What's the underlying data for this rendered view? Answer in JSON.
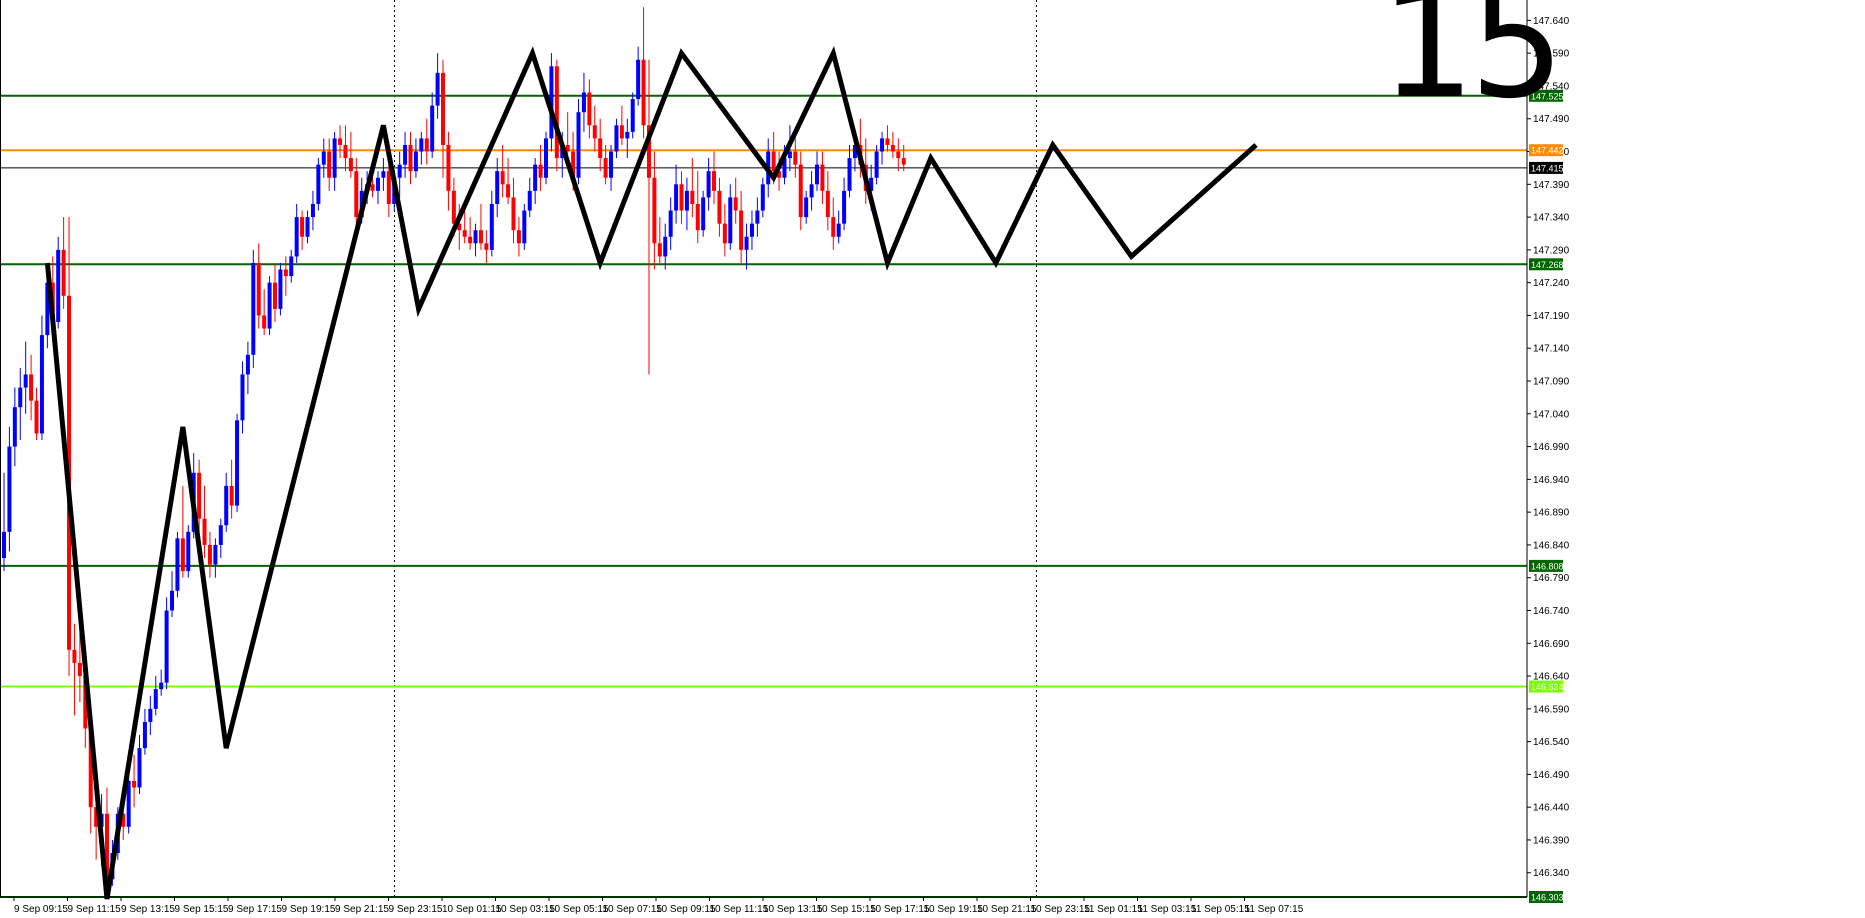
{
  "timeframe_label": "15",
  "chart_data": {
    "type": "candlestick",
    "colors": {
      "bull": "#0000ff",
      "bear": "#ff0000",
      "support_resistance": "#006400",
      "current_price": "#ff8c00",
      "bid_line": "#000000",
      "light_level": "#7cfc00",
      "zigzag": "#000000"
    },
    "ylim": [
      146.303,
      147.665
    ],
    "grid": false,
    "price_ticks": [
      "147.640",
      "147.590",
      "147.540",
      "147.490",
      "147.440",
      "147.390",
      "147.340",
      "147.290",
      "147.240",
      "147.190",
      "147.140",
      "147.090",
      "147.040",
      "146.990",
      "146.940",
      "146.890",
      "146.840",
      "146.790",
      "146.740",
      "146.690",
      "146.640",
      "146.590",
      "146.540",
      "146.490",
      "146.440",
      "146.390",
      "146.340"
    ],
    "time_labels": [
      "9 Sep 09:15",
      "9 Sep 11:15",
      "9 Sep 13:15",
      "9 Sep 15:15",
      "9 Sep 17:15",
      "9 Sep 19:15",
      "9 Sep 21:15",
      "9 Sep 23:15",
      "10 Sep 01:15",
      "10 Sep 03:15",
      "10 Sep 05:15",
      "10 Sep 07:15",
      "10 Sep 09:15",
      "10 Sep 11:15",
      "10 Sep 13:15",
      "10 Sep 15:15",
      "10 Sep 17:15",
      "10 Sep 19:15",
      "10 Sep 21:15",
      "10 Sep 23:15",
      "11 Sep 01:15",
      "11 Sep 03:15",
      "11 Sep 05:15",
      "11 Sep 07:15"
    ],
    "horizontal_levels": [
      {
        "price": 147.525,
        "label": "147.525",
        "kind": "support_resistance"
      },
      {
        "price": 147.442,
        "label": "147.442",
        "kind": "current_price"
      },
      {
        "price": 147.415,
        "label": "147.415",
        "kind": "bid_line"
      },
      {
        "price": 147.268,
        "label": "147.268",
        "kind": "support_resistance"
      },
      {
        "price": 146.808,
        "label": "146.808",
        "kind": "support_resistance"
      },
      {
        "price": 146.624,
        "label": "146.624",
        "kind": "light_level"
      },
      {
        "price": 146.303,
        "label": "146.303",
        "kind": "support_resistance"
      }
    ],
    "day_separators": [
      "9 Sep 23:15",
      "10 Sep 23:15"
    ],
    "zigzag": [
      {
        "t": 8.0,
        "p": 147.27
      },
      {
        "t": 19.0,
        "p": 146.3
      },
      {
        "t": 33.0,
        "p": 147.02
      },
      {
        "t": 41.0,
        "p": 146.53
      },
      {
        "t": 70.0,
        "p": 147.48
      },
      {
        "t": 76.5,
        "p": 147.2
      },
      {
        "t": 97.5,
        "p": 147.59
      },
      {
        "t": 110.0,
        "p": 147.27
      },
      {
        "t": 125.0,
        "p": 147.59
      },
      {
        "t": 142.0,
        "p": 147.4
      },
      {
        "t": 153.0,
        "p": 147.59
      },
      {
        "t": 163.0,
        "p": 147.27
      },
      {
        "t": 171.0,
        "p": 147.43
      },
      {
        "t": 183.0,
        "p": 147.27
      },
      {
        "t": 193.5,
        "p": 147.45
      },
      {
        "t": 208.0,
        "p": 147.28
      },
      {
        "t": 231.0,
        "p": 147.45
      }
    ],
    "candles": [
      [
        146.82,
        146.95,
        146.8,
        146.86
      ],
      [
        146.86,
        147.02,
        146.83,
        146.99
      ],
      [
        146.99,
        147.08,
        146.96,
        147.05
      ],
      [
        147.05,
        147.11,
        147.0,
        147.08
      ],
      [
        147.08,
        147.15,
        147.04,
        147.1
      ],
      [
        147.1,
        147.13,
        147.03,
        147.06
      ],
      [
        147.06,
        147.08,
        147.0,
        147.01
      ],
      [
        147.01,
        147.19,
        147.0,
        147.16
      ],
      [
        147.16,
        147.27,
        147.14,
        147.24
      ],
      [
        147.24,
        147.28,
        147.16,
        147.18
      ],
      [
        147.18,
        147.31,
        147.17,
        147.29
      ],
      [
        147.29,
        147.34,
        147.2,
        147.22
      ],
      [
        147.22,
        147.34,
        146.64,
        146.68
      ],
      [
        146.68,
        146.72,
        146.58,
        146.66
      ],
      [
        146.66,
        146.74,
        146.6,
        146.64
      ],
      [
        146.64,
        146.65,
        146.53,
        146.56
      ],
      [
        146.56,
        146.59,
        146.4,
        146.44
      ],
      [
        146.44,
        146.47,
        146.36,
        146.41
      ],
      [
        146.41,
        146.46,
        146.35,
        146.43
      ],
      [
        146.43,
        146.47,
        146.31,
        146.33
      ],
      [
        146.33,
        146.39,
        146.32,
        146.37
      ],
      [
        146.37,
        146.44,
        146.36,
        146.43
      ],
      [
        146.43,
        146.45,
        146.39,
        146.41
      ],
      [
        146.41,
        146.5,
        146.4,
        146.48
      ],
      [
        146.48,
        146.52,
        146.44,
        146.47
      ],
      [
        146.47,
        146.55,
        146.46,
        146.53
      ],
      [
        146.53,
        146.59,
        146.52,
        146.57
      ],
      [
        146.57,
        146.61,
        146.55,
        146.59
      ],
      [
        146.59,
        146.64,
        146.58,
        146.62
      ],
      [
        146.62,
        146.65,
        146.61,
        146.63
      ],
      [
        146.63,
        146.76,
        146.62,
        146.74
      ],
      [
        146.74,
        146.8,
        146.73,
        146.77
      ],
      [
        146.77,
        146.86,
        146.76,
        146.85
      ],
      [
        146.85,
        146.93,
        146.79,
        146.8
      ],
      [
        146.8,
        146.87,
        146.79,
        146.86
      ],
      [
        146.86,
        146.98,
        146.85,
        146.95
      ],
      [
        146.95,
        146.97,
        146.86,
        146.88
      ],
      [
        146.88,
        146.93,
        146.82,
        146.84
      ],
      [
        146.84,
        146.86,
        146.79,
        146.81
      ],
      [
        146.81,
        146.85,
        146.79,
        146.84
      ],
      [
        146.84,
        146.88,
        146.82,
        146.87
      ],
      [
        146.87,
        146.95,
        146.86,
        146.93
      ],
      [
        146.93,
        146.97,
        146.88,
        146.9
      ],
      [
        146.9,
        147.04,
        146.89,
        147.03
      ],
      [
        147.03,
        147.12,
        147.01,
        147.1
      ],
      [
        147.1,
        147.15,
        147.07,
        147.13
      ],
      [
        147.13,
        147.29,
        147.11,
        147.27
      ],
      [
        147.27,
        147.3,
        147.17,
        147.19
      ],
      [
        147.19,
        147.23,
        147.16,
        147.17
      ],
      [
        147.17,
        147.25,
        147.16,
        147.24
      ],
      [
        147.24,
        147.27,
        147.18,
        147.2
      ],
      [
        147.2,
        147.27,
        147.19,
        147.26
      ],
      [
        147.26,
        147.28,
        147.22,
        147.25
      ],
      [
        147.25,
        147.29,
        147.24,
        147.28
      ],
      [
        147.28,
        147.36,
        147.27,
        147.34
      ],
      [
        147.34,
        147.35,
        147.29,
        147.31
      ],
      [
        147.31,
        147.35,
        147.3,
        147.34
      ],
      [
        147.34,
        147.38,
        147.32,
        147.36
      ],
      [
        147.36,
        147.43,
        147.35,
        147.42
      ],
      [
        147.42,
        147.46,
        147.4,
        147.44
      ],
      [
        147.44,
        147.46,
        147.38,
        147.4
      ],
      [
        147.4,
        147.47,
        147.38,
        147.46
      ],
      [
        147.46,
        147.48,
        147.43,
        147.45
      ],
      [
        147.45,
        147.48,
        147.41,
        147.43
      ],
      [
        147.43,
        147.47,
        147.4,
        147.41
      ],
      [
        147.41,
        147.43,
        147.32,
        147.34
      ],
      [
        147.34,
        147.4,
        147.33,
        147.38
      ],
      [
        147.38,
        147.41,
        147.36,
        147.39
      ],
      [
        147.39,
        147.42,
        147.37,
        147.38
      ],
      [
        147.38,
        147.41,
        147.36,
        147.4
      ],
      [
        147.4,
        147.43,
        147.38,
        147.41
      ],
      [
        147.41,
        147.42,
        147.34,
        147.36
      ],
      [
        147.36,
        147.41,
        147.35,
        147.4
      ],
      [
        147.4,
        147.44,
        147.37,
        147.42
      ],
      [
        147.42,
        147.47,
        147.4,
        147.45
      ],
      [
        147.45,
        147.47,
        147.39,
        147.41
      ],
      [
        147.41,
        147.46,
        147.4,
        147.44
      ],
      [
        147.44,
        147.47,
        147.42,
        147.46
      ],
      [
        147.46,
        147.49,
        147.42,
        147.44
      ],
      [
        147.44,
        147.53,
        147.43,
        147.51
      ],
      [
        147.51,
        147.59,
        147.49,
        147.56
      ],
      [
        147.56,
        147.58,
        147.4,
        147.45
      ],
      [
        147.45,
        147.47,
        147.35,
        147.38
      ],
      [
        147.38,
        147.4,
        147.31,
        147.33
      ],
      [
        147.33,
        147.36,
        147.29,
        147.32
      ],
      [
        147.32,
        147.35,
        147.3,
        147.31
      ],
      [
        147.31,
        147.34,
        147.29,
        147.3
      ],
      [
        147.3,
        147.33,
        147.28,
        147.32
      ],
      [
        147.32,
        147.36,
        147.29,
        147.3
      ],
      [
        147.3,
        147.32,
        147.27,
        147.29
      ],
      [
        147.29,
        147.38,
        147.28,
        147.36
      ],
      [
        147.36,
        147.43,
        147.34,
        147.41
      ],
      [
        147.41,
        147.45,
        147.37,
        147.39
      ],
      [
        147.39,
        147.43,
        147.36,
        147.37
      ],
      [
        147.37,
        147.4,
        147.3,
        147.32
      ],
      [
        147.32,
        147.34,
        147.28,
        147.3
      ],
      [
        147.3,
        147.36,
        147.29,
        147.35
      ],
      [
        147.35,
        147.4,
        147.34,
        147.38
      ],
      [
        147.38,
        147.43,
        147.36,
        147.42
      ],
      [
        147.42,
        147.45,
        147.38,
        147.4
      ],
      [
        147.4,
        147.47,
        147.39,
        147.46
      ],
      [
        147.46,
        147.59,
        147.44,
        147.57
      ],
      [
        147.57,
        147.58,
        147.41,
        147.43
      ],
      [
        147.43,
        147.47,
        147.4,
        147.45
      ],
      [
        147.45,
        147.5,
        147.42,
        147.44
      ],
      [
        147.44,
        147.47,
        147.38,
        147.4
      ],
      [
        147.4,
        147.52,
        147.39,
        147.5
      ],
      [
        147.5,
        147.56,
        147.47,
        147.53
      ],
      [
        147.53,
        147.55,
        147.46,
        147.48
      ],
      [
        147.48,
        147.51,
        147.44,
        147.46
      ],
      [
        147.46,
        147.49,
        147.41,
        147.43
      ],
      [
        147.43,
        147.45,
        147.39,
        147.4
      ],
      [
        147.4,
        147.45,
        147.38,
        147.44
      ],
      [
        147.44,
        147.49,
        147.43,
        147.48
      ],
      [
        147.48,
        147.51,
        147.45,
        147.46
      ],
      [
        147.46,
        147.49,
        147.43,
        147.47
      ],
      [
        147.47,
        147.53,
        147.46,
        147.52
      ],
      [
        147.52,
        147.6,
        147.51,
        147.58
      ],
      [
        147.58,
        147.66,
        147.46,
        147.48
      ],
      [
        147.48,
        147.58,
        147.1,
        147.4
      ],
      [
        147.4,
        147.44,
        147.26,
        147.3
      ],
      [
        147.3,
        147.34,
        147.27,
        147.28
      ],
      [
        147.28,
        147.33,
        147.26,
        147.31
      ],
      [
        147.31,
        147.37,
        147.29,
        147.35
      ],
      [
        147.35,
        147.42,
        147.33,
        147.39
      ],
      [
        147.39,
        147.41,
        147.33,
        147.35
      ],
      [
        147.35,
        147.4,
        147.32,
        147.38
      ],
      [
        147.38,
        147.43,
        147.34,
        147.36
      ],
      [
        147.36,
        147.41,
        147.3,
        147.32
      ],
      [
        147.32,
        147.38,
        147.31,
        147.37
      ],
      [
        147.37,
        147.43,
        147.35,
        147.41
      ],
      [
        147.41,
        147.44,
        147.36,
        147.38
      ],
      [
        147.38,
        147.4,
        147.31,
        147.33
      ],
      [
        147.33,
        147.36,
        147.28,
        147.3
      ],
      [
        147.3,
        147.39,
        147.29,
        147.37
      ],
      [
        147.37,
        147.4,
        147.33,
        147.35
      ],
      [
        147.35,
        147.38,
        147.27,
        147.29
      ],
      [
        147.29,
        147.33,
        147.26,
        147.31
      ],
      [
        147.31,
        147.35,
        147.29,
        147.33
      ],
      [
        147.33,
        147.37,
        147.31,
        147.35
      ],
      [
        147.35,
        147.4,
        147.34,
        147.39
      ],
      [
        147.39,
        147.46,
        147.37,
        147.44
      ],
      [
        147.44,
        147.47,
        147.39,
        147.41
      ],
      [
        147.41,
        147.44,
        147.38,
        147.4
      ],
      [
        147.4,
        147.45,
        147.39,
        147.43
      ],
      [
        147.43,
        147.48,
        147.41,
        147.44
      ],
      [
        147.44,
        147.46,
        147.4,
        147.42
      ],
      [
        147.42,
        147.44,
        147.32,
        147.34
      ],
      [
        147.34,
        147.38,
        147.33,
        147.37
      ],
      [
        147.37,
        147.41,
        147.35,
        147.39
      ],
      [
        147.39,
        147.44,
        147.38,
        147.42
      ],
      [
        147.42,
        147.44,
        147.36,
        147.38
      ],
      [
        147.38,
        147.41,
        147.32,
        147.34
      ],
      [
        147.34,
        147.37,
        147.29,
        147.31
      ],
      [
        147.31,
        147.35,
        147.3,
        147.33
      ],
      [
        147.33,
        147.4,
        147.32,
        147.38
      ],
      [
        147.38,
        147.45,
        147.37,
        147.43
      ],
      [
        147.43,
        147.47,
        147.41,
        147.45
      ],
      [
        147.45,
        147.49,
        147.4,
        147.42
      ],
      [
        147.42,
        147.46,
        147.36,
        147.38
      ],
      [
        147.38,
        147.42,
        147.35,
        147.4
      ],
      [
        147.4,
        147.45,
        147.39,
        147.44
      ],
      [
        147.44,
        147.47,
        147.42,
        147.46
      ],
      [
        147.46,
        147.48,
        147.44,
        147.45
      ],
      [
        147.45,
        147.47,
        147.43,
        147.44
      ],
      [
        147.44,
        147.46,
        147.41,
        147.43
      ],
      [
        147.43,
        147.45,
        147.41,
        147.42
      ]
    ]
  }
}
